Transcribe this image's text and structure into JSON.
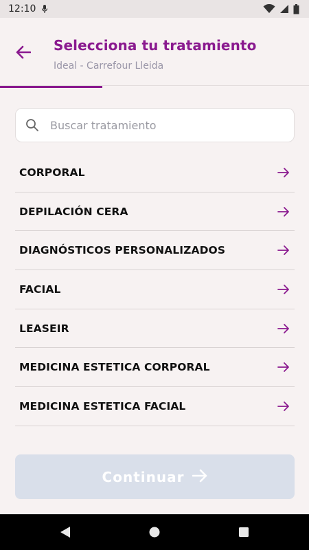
{
  "status_bar": {
    "time": "12:10"
  },
  "header": {
    "title": "Selecciona tu tratamiento",
    "subtitle": "Ideal - Carrefour Lleida",
    "progress": 0.33
  },
  "search": {
    "placeholder": "Buscar tratamiento",
    "value": ""
  },
  "treatments": [
    {
      "label": "CORPORAL"
    },
    {
      "label": "DEPILACIÓN CERA"
    },
    {
      "label": "DIAGNÓSTICOS PERSONALIZADOS"
    },
    {
      "label": "FACIAL"
    },
    {
      "label": "LEASEIR"
    },
    {
      "label": "MEDICINA ESTETICA CORPORAL"
    },
    {
      "label": "MEDICINA ESTETICA FACIAL"
    }
  ],
  "continue_button": {
    "label": "Continuar"
  },
  "colors": {
    "accent": "#8a1a8f",
    "subtitle": "#9a96a8",
    "button_disabled": "#d9dfea",
    "background": "#f7f2f2"
  },
  "icons": {
    "back": "arrow-left-icon",
    "search": "search-icon",
    "item_arrow": "arrow-right-icon",
    "continue_arrow": "arrow-right-icon"
  }
}
